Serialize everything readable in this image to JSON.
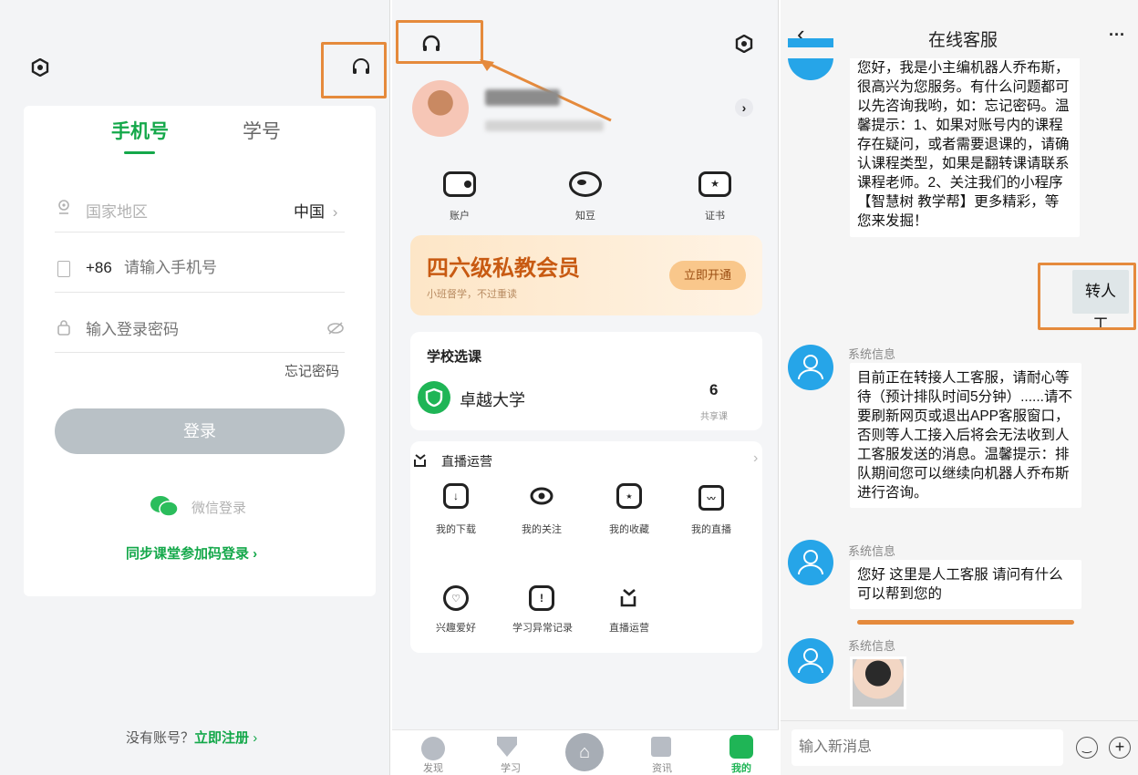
{
  "login": {
    "tab_phone": "手机号",
    "tab_student": "学号",
    "country_label": "国家地区",
    "country_value": "中国",
    "phone_prefix": "+86",
    "phone_placeholder": "请输入手机号",
    "password_placeholder": "输入登录密码",
    "forgot": "忘记密码",
    "login_btn": "登录",
    "wechat": "微信登录",
    "sync_login": "同步课堂参加码登录",
    "no_account": "没有账号？",
    "register": "立即注册"
  },
  "profile": {
    "quick": [
      {
        "label": "账户"
      },
      {
        "label": "知豆"
      },
      {
        "label": "证书"
      }
    ],
    "vip_title": "四六级私教会员",
    "vip_sub": "小班督学，不过重读",
    "vip_btn": "立即开通",
    "school_title": "学校选课",
    "school_name": "卓越大学",
    "shared_count": "6",
    "shared_label": "共享课",
    "live_title": "直播运营",
    "grid": [
      {
        "label": "我的下载",
        "icon": "download-icon"
      },
      {
        "label": "我的关注",
        "icon": "eye-icon"
      },
      {
        "label": "我的收藏",
        "icon": "star-folder-icon"
      },
      {
        "label": "我的直播",
        "icon": "tv-icon"
      },
      {
        "label": "兴趣爱好",
        "icon": "heart-icon"
      },
      {
        "label": "学习异常记录",
        "icon": "alert-icon"
      },
      {
        "label": "直播运营",
        "icon": "live-icon"
      }
    ],
    "nav": [
      {
        "label": "发现",
        "icon": "compass-icon"
      },
      {
        "label": "学习",
        "icon": "diamond-icon"
      },
      {
        "label": "",
        "icon": "home-icon"
      },
      {
        "label": "资讯",
        "icon": "news-icon"
      },
      {
        "label": "我的",
        "icon": "me-icon"
      }
    ]
  },
  "chat": {
    "title": "在线客服",
    "back": "‹",
    "more": "···",
    "messages": [
      {
        "sender": "",
        "text": "您好，我是小主编机器人乔布斯，很高兴为您服务。有什么问题都可以先咨询我哟，如：忘记密码。温馨提示：1、如果对账号内的课程存在疑问，或者需要退课的，请确认课程类型，如果是翻转课请联系课程老师。2、关注我们的小程序【智慧树 教学帮】更多精彩，等您来发掘！"
      },
      {
        "sender": "me",
        "text": "转人工"
      },
      {
        "sender": "系统信息",
        "text": "目前正在转接人工客服，请耐心等待（预计排队时间5分钟）......请不要刷新网页或退出APP客服窗口，否则等人工接入后将会无法收到人工客服发送的消息。温馨提示：排队期间您可以继续向机器人乔布斯进行咨询。"
      },
      {
        "sender": "系统信息",
        "text": "您好 这里是人工客服 请问有什么可以帮到您的"
      },
      {
        "sender": "系统信息",
        "text": ""
      }
    ],
    "input_placeholder": "输入新消息"
  }
}
